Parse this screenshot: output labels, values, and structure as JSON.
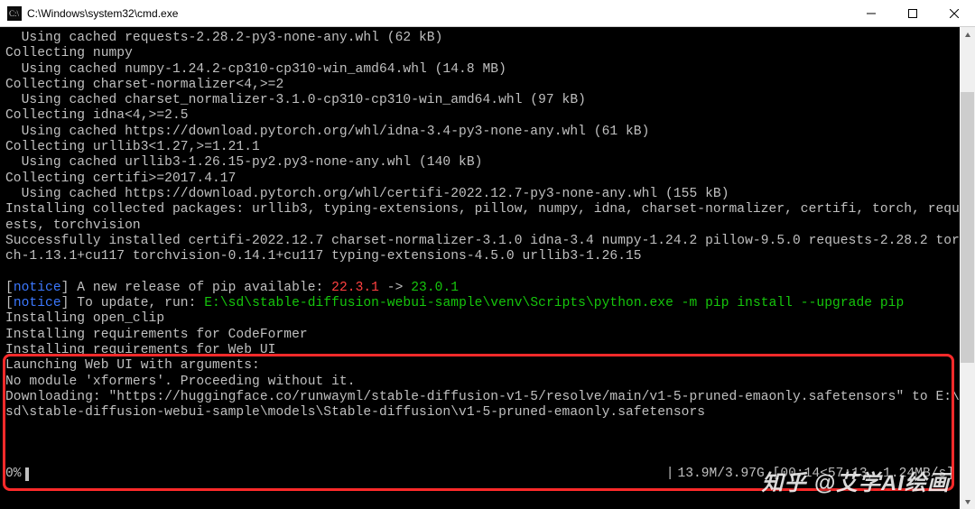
{
  "window": {
    "title": "C:\\Windows\\system32\\cmd.exe"
  },
  "terminal": {
    "lines": [
      {
        "segs": [
          {
            "t": "  Using cached requests-2.28.2-py3-none-any.whl (62 kB)"
          }
        ]
      },
      {
        "segs": [
          {
            "t": "Collecting numpy"
          }
        ]
      },
      {
        "segs": [
          {
            "t": "  Using cached numpy-1.24.2-cp310-cp310-win_amd64.whl (14.8 MB)"
          }
        ]
      },
      {
        "segs": [
          {
            "t": "Collecting charset-normalizer<4,>=2"
          }
        ]
      },
      {
        "segs": [
          {
            "t": "  Using cached charset_normalizer-3.1.0-cp310-cp310-win_amd64.whl (97 kB)"
          }
        ]
      },
      {
        "segs": [
          {
            "t": "Collecting idna<4,>=2.5"
          }
        ]
      },
      {
        "segs": [
          {
            "t": "  Using cached https://download.pytorch.org/whl/idna-3.4-py3-none-any.whl (61 kB)"
          }
        ]
      },
      {
        "segs": [
          {
            "t": "Collecting urllib3<1.27,>=1.21.1"
          }
        ]
      },
      {
        "segs": [
          {
            "t": "  Using cached urllib3-1.26.15-py2.py3-none-any.whl (140 kB)"
          }
        ]
      },
      {
        "segs": [
          {
            "t": "Collecting certifi>=2017.4.17"
          }
        ]
      },
      {
        "segs": [
          {
            "t": "  Using cached https://download.pytorch.org/whl/certifi-2022.12.7-py3-none-any.whl (155 kB)"
          }
        ]
      },
      {
        "segs": [
          {
            "t": "Installing collected packages: urllib3, typing-extensions, pillow, numpy, idna, charset-normalizer, certifi, torch, requ"
          }
        ]
      },
      {
        "segs": [
          {
            "t": "ests, torchvision"
          }
        ]
      },
      {
        "segs": [
          {
            "t": "Successfully installed certifi-2022.12.7 charset-normalizer-3.1.0 idna-3.4 numpy-1.24.2 pillow-9.5.0 requests-2.28.2 tor"
          }
        ]
      },
      {
        "segs": [
          {
            "t": "ch-1.13.1+cu117 torchvision-0.14.1+cu117 typing-extensions-4.5.0 urllib3-1.26.15"
          }
        ]
      },
      {
        "segs": [
          {
            "t": ""
          }
        ]
      },
      {
        "segs": [
          {
            "t": "[",
            "c": "c-gray"
          },
          {
            "t": "notice",
            "c": "c-blue"
          },
          {
            "t": "] A new release of pip available: ",
            "c": "c-gray"
          },
          {
            "t": "22.3.1",
            "c": "c-red"
          },
          {
            "t": " -> ",
            "c": "c-gray"
          },
          {
            "t": "23.0.1",
            "c": "c-green"
          }
        ]
      },
      {
        "segs": [
          {
            "t": "[",
            "c": "c-gray"
          },
          {
            "t": "notice",
            "c": "c-blue"
          },
          {
            "t": "] To update, run: ",
            "c": "c-gray"
          },
          {
            "t": "E:\\sd\\stable-diffusion-webui-sample\\venv\\Scripts\\python.exe -m pip install --upgrade pip",
            "c": "c-green"
          }
        ]
      },
      {
        "segs": [
          {
            "t": "Installing open_clip"
          }
        ]
      },
      {
        "segs": [
          {
            "t": "Installing requirements for CodeFormer"
          }
        ]
      },
      {
        "segs": [
          {
            "t": "Installing requirements for Web UI"
          }
        ]
      },
      {
        "segs": [
          {
            "t": "Launching Web UI with arguments:"
          }
        ]
      },
      {
        "segs": [
          {
            "t": "No module 'xformers'. Proceeding without it."
          }
        ]
      },
      {
        "segs": [
          {
            "t": "Downloading: \"https://huggingface.co/runwayml/stable-diffusion-v1-5/resolve/main/v1-5-pruned-emaonly.safetensors\" to E:\\"
          }
        ]
      },
      {
        "segs": [
          {
            "t": "sd\\stable-diffusion-webui-sample\\models\\Stable-diffusion\\v1-5-pruned-emaonly.safetensors"
          }
        ]
      },
      {
        "segs": [
          {
            "t": ""
          }
        ]
      }
    ]
  },
  "progress": {
    "percent": "0%",
    "stats": "13.9M/3.97G [00:14<57:13, 1.24MB/s]"
  },
  "watermark": {
    "prefix": "知乎",
    "text": "@艾学AI绘画"
  }
}
